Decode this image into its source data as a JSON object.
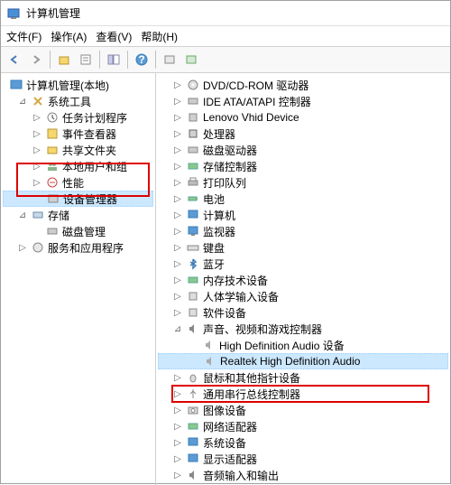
{
  "window": {
    "title": "计算机管理"
  },
  "menu": {
    "file": "文件(F)",
    "action": "操作(A)",
    "view": "查看(V)",
    "help": "帮助(H)"
  },
  "left_tree": {
    "root": "计算机管理(本地)",
    "system_tools": "系统工具",
    "task_scheduler": "任务计划程序",
    "event_viewer": "事件查看器",
    "shared_folders": "共享文件夹",
    "local_users": "本地用户和组",
    "performance": "性能",
    "device_manager": "设备管理器",
    "storage": "存储",
    "disk_mgmt": "磁盘管理",
    "services_apps": "服务和应用程序"
  },
  "right_tree": {
    "dvd": "DVD/CD-ROM 驱动器",
    "ide": "IDE ATA/ATAPI 控制器",
    "lenovo": "Lenovo Vhid Device",
    "cpu": "处理器",
    "disk": "磁盘驱动器",
    "storage_ctrl": "存储控制器",
    "print": "打印队列",
    "battery": "电池",
    "computer": "计算机",
    "monitor": "监视器",
    "keyboard": "键盘",
    "bluetooth": "蓝牙",
    "memory": "内存技术设备",
    "hid": "人体学输入设备",
    "software": "软件设备",
    "sound": "声音、视频和游戏控制器",
    "hd_audio": "High Definition Audio 设备",
    "realtek": "Realtek High Definition Audio",
    "mouse": "鼠标和其他指针设备",
    "usb": "通用串行总线控制器",
    "imaging": "图像设备",
    "network": "网络适配器",
    "system": "系统设备",
    "display": "显示适配器",
    "audio_io": "音频输入和输出"
  }
}
